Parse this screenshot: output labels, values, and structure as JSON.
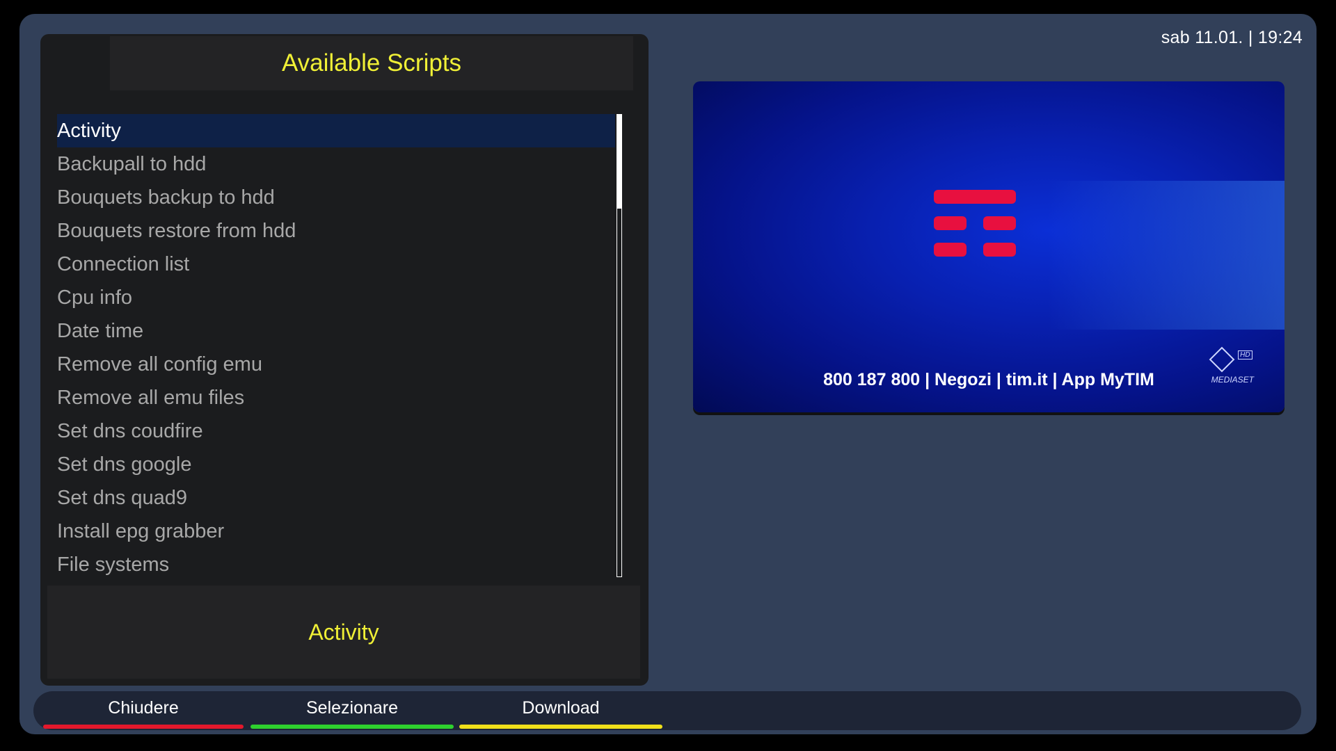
{
  "clock": "sab 11.01. | 19:24",
  "title": "Available Scripts",
  "scripts": [
    "Activity",
    "Backupall to hdd",
    "Bouquets backup to hdd",
    "Bouquets restore from hdd",
    "Connection list",
    "Cpu info",
    "Date time",
    "Remove all config emu",
    "Remove all emu files",
    "Set dns coudfire",
    "Set dns google",
    "Set dns quad9",
    "Install epg grabber",
    "File systems"
  ],
  "selected_index": 0,
  "description": "Activity",
  "preview": {
    "promo_text": "800 187 800 | Negozi | tim.it | App MyTIM",
    "channel_logo_text": "MEDIASET",
    "channel_logo_badge": "HD"
  },
  "footer": {
    "buttons": [
      {
        "label": "Chiudere",
        "color": "#e3182c"
      },
      {
        "label": "Selezionare",
        "color": "#2ed12e"
      },
      {
        "label": "Download",
        "color": "#f0e01a"
      }
    ]
  },
  "colors": {
    "accent_yellow": "#f0f036",
    "selection": "#0e2147"
  }
}
